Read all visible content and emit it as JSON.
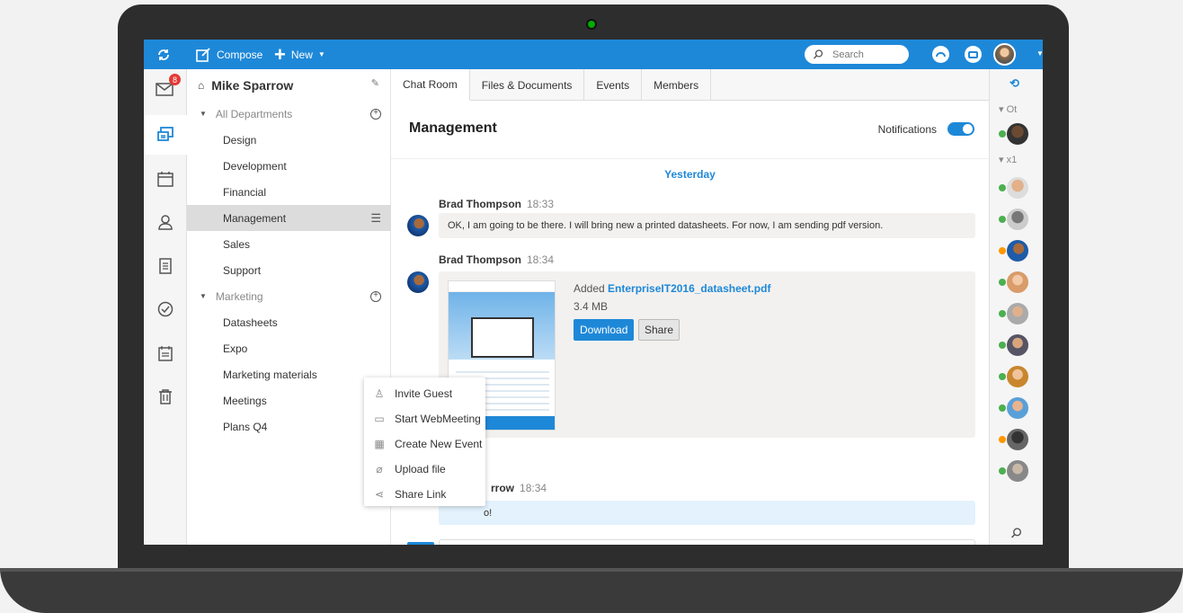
{
  "topbar": {
    "compose_label": "Compose",
    "new_label": "New",
    "search_placeholder": "Search"
  },
  "leftnav": {
    "mail_badge": "8"
  },
  "folders": {
    "owner": "Mike Sparrow",
    "groups": [
      {
        "label": "All Departments",
        "items": [
          "Design",
          "Development",
          "Financial",
          "Management",
          "Sales",
          "Support"
        ]
      },
      {
        "label": "Marketing",
        "items": [
          "Datasheets",
          "Expo",
          "Marketing materials",
          "Meetings",
          "Plans Q4"
        ]
      }
    ],
    "selected": "Management"
  },
  "tabs": [
    "Chat Room",
    "Files & Documents",
    "Events",
    "Members"
  ],
  "room": {
    "title": "Management",
    "notifications_label": "Notifications"
  },
  "chat": {
    "day_label": "Yesterday",
    "messages": [
      {
        "author": "Brad Thompson",
        "time": "18:33",
        "text": "OK, I am going to be there. I will bring new a printed datasheets. For now, I am sending pdf version."
      },
      {
        "author": "Brad Thompson",
        "time": "18:34",
        "file_prefix": "Added",
        "file_name": "EnterpriseIT2016_datasheet.pdf",
        "file_size": "3.4 MB",
        "download_label": "Download",
        "share_label": "Share"
      },
      {
        "author_partial": "rrow",
        "time": "18:34",
        "text_partial": "o!"
      }
    ]
  },
  "popup": {
    "items": [
      {
        "label": "Invite Guest",
        "icon": "user-plus-icon"
      },
      {
        "label": "Start WebMeeting",
        "icon": "monitor-icon"
      },
      {
        "label": "Create New Event",
        "icon": "calendar-icon"
      },
      {
        "label": "Upload file",
        "icon": "paperclip-icon"
      },
      {
        "label": "Share Link",
        "icon": "share-icon"
      }
    ]
  },
  "rightbar": {
    "groups": [
      "Ot",
      "x1"
    ]
  },
  "colors": {
    "accent": "#1e88d8",
    "online": "#4caf50",
    "away": "#ff9800"
  }
}
